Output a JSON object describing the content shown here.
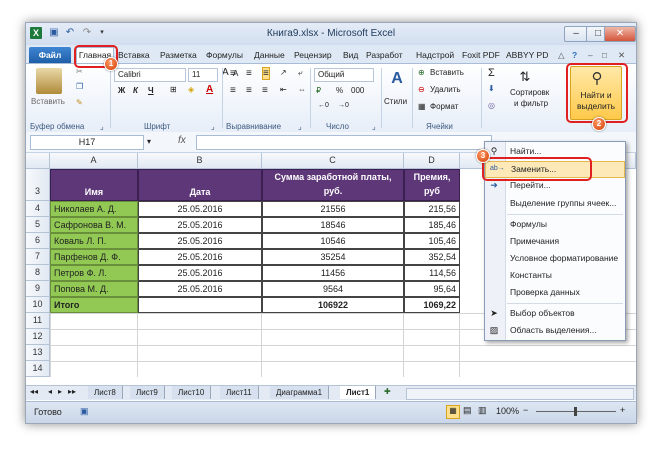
{
  "window": {
    "title": "Книга9.xlsx - Microsoft Excel",
    "qat_icons": [
      "excel-logo-icon",
      "save-icon",
      "undo-icon",
      "redo-icon",
      "customize-qat-icon"
    ]
  },
  "tabs": [
    "Файл",
    "Главная",
    "Вставка",
    "Разметка",
    "Формулы",
    "Данные",
    "Рецензир",
    "Вид",
    "Разработ",
    "Надстрой",
    "Foxit PDF",
    "ABBYY PD"
  ],
  "ribbon": {
    "paste_label": "Вставить",
    "clipboard_group": "Буфер обмена",
    "font_name": "Calibri",
    "font_size": "11",
    "font_group": "Шрифт",
    "bold": "Ж",
    "italic": "К",
    "underline": "Ч",
    "alignment_group": "Выравнивание",
    "number_format": "Общий",
    "number_group": "Число",
    "percent": "%",
    "thousands": "000",
    "styles_label": "Стили",
    "insert_cells": "Вставить",
    "delete_cells": "Удалить",
    "format_cells": "Формат",
    "cells_group": "Ячейки",
    "sigma": "Σ",
    "sort_label": "Сортировк\nи фильтр",
    "sort_line1": "Сортировк",
    "sort_line2": "и фильтр",
    "find_line1": "Найти и",
    "find_line2": "выделить"
  },
  "formula_bar": {
    "name_box": "H17",
    "fx": "fx",
    "value": ""
  },
  "grid": {
    "columns": [
      "A",
      "B",
      "C",
      "D"
    ],
    "row_numbers": [
      "3",
      "4",
      "5",
      "6",
      "7",
      "8",
      "9",
      "10",
      "11",
      "12",
      "13",
      "14"
    ],
    "header": {
      "name": "Имя",
      "date": "Дата",
      "salary_line1": "Сумма заработной платы,",
      "salary_line2": "руб.",
      "bonus_line1": "Премия,",
      "bonus_line2": "руб"
    },
    "rows": [
      {
        "name": "Николаев А. Д.",
        "date": "25.05.2016",
        "salary": "21556",
        "bonus": "215,56"
      },
      {
        "name": "Сафронова В. М.",
        "date": "25.05.2016",
        "salary": "18546",
        "bonus": "185,46"
      },
      {
        "name": "Коваль Л. П.",
        "date": "25.05.2016",
        "salary": "10546",
        "bonus": "105,46"
      },
      {
        "name": "Парфенов Д. Ф.",
        "date": "25.05.2016",
        "salary": "35254",
        "bonus": "352,54"
      },
      {
        "name": "Петров Ф. Л.",
        "date": "25.05.2016",
        "salary": "11456",
        "bonus": "114,56"
      },
      {
        "name": "Попова М. Д.",
        "date": "25.05.2016",
        "salary": "9564",
        "bonus": "95,64"
      }
    ],
    "total": {
      "name": "Итого",
      "salary": "106922",
      "bonus": "1069,22"
    }
  },
  "menu": {
    "items": [
      "Найти...",
      "Заменить...",
      "Перейти...",
      "Выделение группы ячеек...",
      "Формулы",
      "Примечания",
      "Условное форматирование",
      "Константы",
      "Проверка данных",
      "Выбор объектов",
      "Область выделения..."
    ]
  },
  "sheets": [
    "Лист8",
    "Лист9",
    "Лист10",
    "Лист11",
    "Диаграмма1",
    "Лист1"
  ],
  "status": {
    "ready": "Готово",
    "zoom": "100%",
    "minus": "−",
    "plus": "+"
  },
  "callouts": {
    "one": "1",
    "two": "2",
    "three": "3"
  },
  "colors": {
    "header_purple": "#5e3778",
    "total_green": "#92c954",
    "file_tab_blue": "#2a6cc0",
    "callout_red": "#e02020"
  }
}
